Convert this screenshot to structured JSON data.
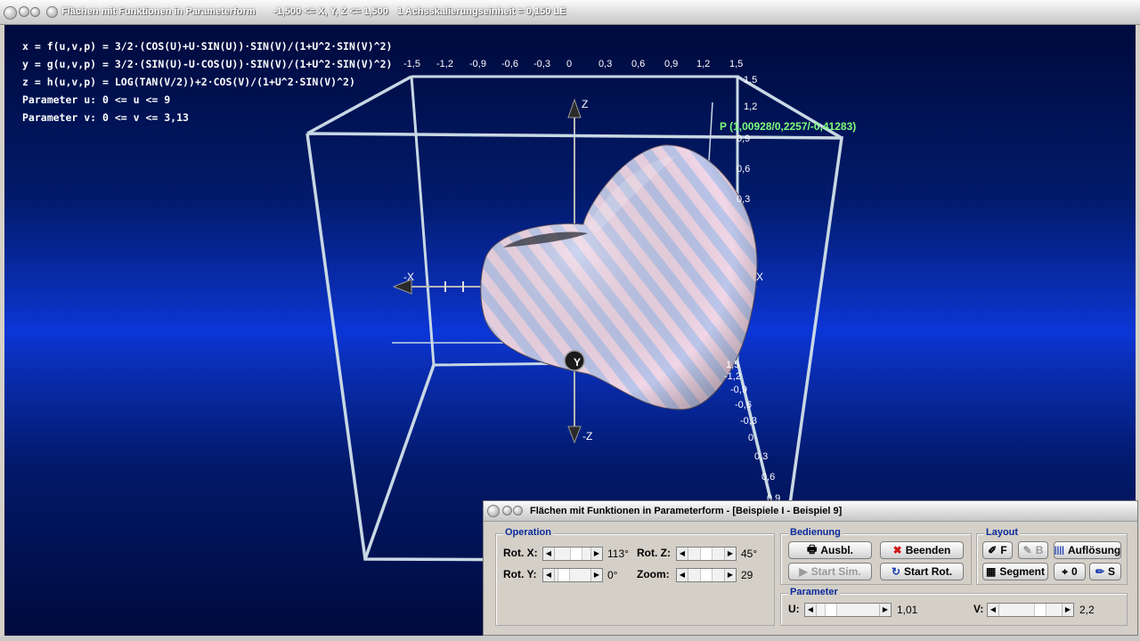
{
  "window": {
    "title": "Flächen mit Funktionen in Parameterform",
    "range": "-1,500 <= X, Y, Z <= 1,500",
    "scale": "1 Achsskalierungseinheit = 0,150 LE"
  },
  "formulas": [
    "x = f(u,v,p) = 3/2·(COS(U)+U·SIN(U))·SIN(V)/(1+U^2·SIN(V)^2)",
    "y = g(u,v,p) = 3/2·(SIN(U)-U·COS(U))·SIN(V)/(1+U^2·SIN(V)^2)",
    "z = h(u,v,p) = LOG(TAN(V/2))+2·COS(V)/(1+U^2·SIN(V)^2)",
    "Parameter u: 0 <= u <= 9",
    "Parameter v: 0 <= v <= 3,13"
  ],
  "top_ticks": [
    "-1,5",
    "-1,2",
    "-0,9",
    "-0,6",
    "-0,3",
    "0",
    "0,3",
    "0,6",
    "0,9",
    "1,2",
    "1,5"
  ],
  "right_ticks_upper": [
    "1,5",
    "1,2",
    "0,9",
    "0,6",
    "0,3"
  ],
  "right_ticks_lower": [
    "1,5",
    "-1,2",
    "-0,9",
    "-0,6",
    "-0,3",
    "0",
    "0,3",
    "0,6",
    "0,9"
  ],
  "point_label": "P (1,00928/0,2257/-0,41283)",
  "axes": {
    "z": "Z",
    "neg_z": "-Z",
    "x": "X",
    "neg_x": "-X",
    "y": "Y"
  },
  "colors": {
    "point_label": "#7cff7c",
    "group_label": "#0a2a9a",
    "beenden_icon": "#d01818"
  },
  "dialog": {
    "title": "Flächen mit Funktionen in Parameterform - [Beispiele I - Beispiel 9]",
    "operation": {
      "label": "Operation",
      "rot_x_label": "Rot. X:",
      "rot_x_value": "113°",
      "rot_y_label": "Rot. Y:",
      "rot_y_value": "0°",
      "rot_z_label": "Rot. Z:",
      "rot_z_value": "45°",
      "zoom_label": "Zoom:",
      "zoom_value": "29"
    },
    "bedienung": {
      "label": "Bedienung",
      "ausbl": "Ausbl.",
      "beenden": "Beenden",
      "start_sim": "Start Sim.",
      "start_rot": "Start Rot."
    },
    "layout": {
      "label": "Layout",
      "f": "F",
      "b": "B",
      "aufloesung": "Auflösung",
      "segment": "Segment",
      "zero": "0",
      "s": "S"
    },
    "parameter": {
      "label": "Parameter",
      "u_label": "U:",
      "u_value": "1,01",
      "v_label": "V:",
      "v_value": "2,2"
    }
  }
}
